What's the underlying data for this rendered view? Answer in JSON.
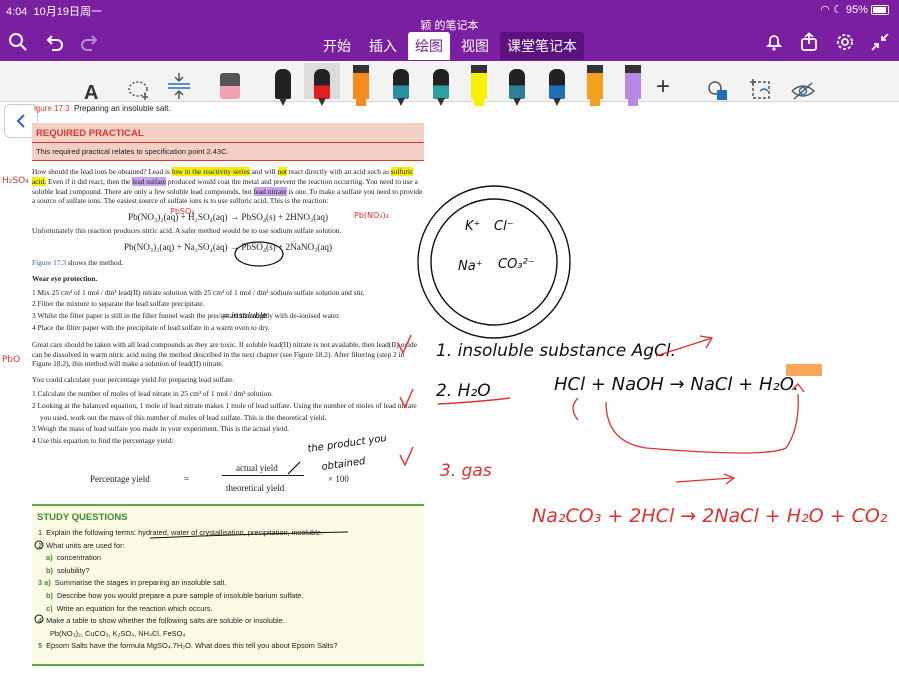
{
  "status": {
    "time": "4:04",
    "date": "10月19日周一",
    "battery": "95%"
  },
  "app": {
    "doc_title": "颖 的笔记本"
  },
  "tabs": [
    "开始",
    "插入",
    "绘图",
    "视图",
    "课堂笔记本"
  ],
  "active_tab": "绘图",
  "toolbar": {
    "text_tool": "A",
    "pens": [
      {
        "name": "black-pen",
        "color": "#222222"
      },
      {
        "name": "red-pen",
        "color": "#e02020"
      },
      {
        "name": "orange-highlighter",
        "color": "#f58a1f"
      },
      {
        "name": "teal-pen",
        "color": "#2a8fa0"
      },
      {
        "name": "teal-pen-2",
        "color": "#2aa0a0"
      },
      {
        "name": "yellow-highlighter",
        "color": "#f7f000"
      },
      {
        "name": "teal-pen-3",
        "color": "#2f7f9a"
      },
      {
        "name": "blue-pen",
        "color": "#1f6fbf"
      },
      {
        "name": "orange-highlighter-2",
        "color": "#f5a020"
      },
      {
        "name": "purple-highlighter",
        "color": "#b88ae6"
      }
    ]
  },
  "page": {
    "figure_label": "igure 17.3",
    "figure_text": "Preparing an insoluble salt.",
    "req_title": "REQUIRED PRACTICAL",
    "req_sub": "This required practical relates to specification point 2.43C.",
    "p1": {
      "a": "How should the lead ions be obtained? Lead is ",
      "h1": "low in the reactivity series",
      "b": " and will ",
      "h2": "not",
      "c": " react directly with an acid such as ",
      "h3": "sulfuric acid.",
      "d": " Even if it did react, then the ",
      "h4": "lead sulfate",
      "e": " produced would coat the metal and prevent the reaction occurring. You need to use a soluble lead compound. There are only a few soluble lead compounds, but ",
      "h5": "lead nitrate",
      "f": " is one. To make a sulfate you need to provide a source of sulfate ions. The easiest source of sulfate ions is to use sulfuric acid. This is the reaction:"
    },
    "eq1": "Pb(NO₃)₂(aq) + H₂SO₄(aq) → PbSO₄(s) + 2HNO₃(aq)",
    "p2": "Unfortunately this reaction produces nitric acid. A safer method would be to use sodium sulfate solution.",
    "eq2": "Pb(NO₃)₂(aq) + Na₂SO₄(aq) → PbSO₄(s) + 2NaNO₃(aq)",
    "p3a": "Figure 17.3",
    "p3b": " shows the method.",
    "wear": "Wear eye protection.",
    "steps": [
      "1  Mix 25 cm³ of 1 mol / dm³ lead(II) nitrate solution with 25 cm³ of 1 mol / dm³ sodium sulfate solution and stir.",
      "2  Filter the mixture to separate the lead sulfate precipitate.",
      "3  Whilst the filter paper is still in the filter funnel wash the precipitate thoroughly with de-ionised water.",
      "4  Place the filter paper with the precipitate of lead sulfate in a warm oven to dry."
    ],
    "p4": "Great care should be taken with all lead compounds as they are toxic. If soluble lead(II) nitrate is not available, then lead(II) oxide can be dissolved in warm nitric acid using the method described in the next chapter (see Figure 18.2). After filtering (step 2 in Figure 18.2), this method will make a solution of lead(II) nitrate.",
    "p5": "You could calculate your percentage yield for preparing lead sulfate.",
    "calc": [
      "1  Calculate the number of moles of lead nitrate in 25 cm³ of 1 mol / dm³ solution.",
      "2  Looking at the balanced equation, 1 mole of lead nitrate makes 1 mole of lead sulfate. Using the number of moles of lead nitrate you used, work out the mass of this number of moles of lead sulfate. This is the theoretical yield.",
      "3  Weigh the mass of lead sulfate you made in your experiment. This is the actual yield.",
      "4  Use this equation to find the percentage yield:"
    ],
    "pct_label": "Percentage yield",
    "pct_eq": "=",
    "pct_num": "actual yield",
    "pct_den": "theoretical yield",
    "pct_times": "× 100"
  },
  "study": {
    "title": "STUDY QUESTIONS",
    "items": [
      {
        "n": "1",
        "t": "Explain the following terms: hydrated, water of crystallisation, precipitation, insoluble."
      },
      {
        "n": "2",
        "t": "What units are used for:"
      },
      {
        "n": "a)",
        "t": "concentration"
      },
      {
        "n": "b)",
        "t": "solubility?"
      },
      {
        "n": "3 a)",
        "t": "Summarise the stages in preparing an insoluble salt."
      },
      {
        "n": "b)",
        "t": "Describe how you would prepare a pure sample of insoluble barium sulfate."
      },
      {
        "n": "c)",
        "t": "Write an equation for the reaction which occurs."
      },
      {
        "n": "4",
        "t": "Make a table to show whether the following salts are soluble or insoluble."
      },
      {
        "n": "",
        "t": "Pb(NO₃)₂, CuCO₃, K₂SO₄, NH₄Cl, FeSO₄"
      },
      {
        "n": "5",
        "t": "Epsom Salts have the formula MgSO₄.7H₂O. What does this tell you about Epsom Salts?"
      }
    ]
  },
  "ink": {
    "h2so4": "H₂SO₄",
    "pbso4": "PbSO₄",
    "pbno3": "Pb(NO₃)₂",
    "insoluble": "= insoluble",
    "pbo": "PbO",
    "product": "the product you obtained",
    "ions": [
      "K⁺",
      "Cl⁻",
      "Na⁺",
      "CO₃²⁻"
    ],
    "line1": "1. insoluble substance   AgCl.",
    "line2": "2. H₂O",
    "eq_a": "HCl + NaOH  →  NaCl + H₂O.",
    "line3": "3. gas",
    "eq_b": "Na₂CO₃ + 2HCl → 2NaCl + H₂O + CO₂"
  }
}
